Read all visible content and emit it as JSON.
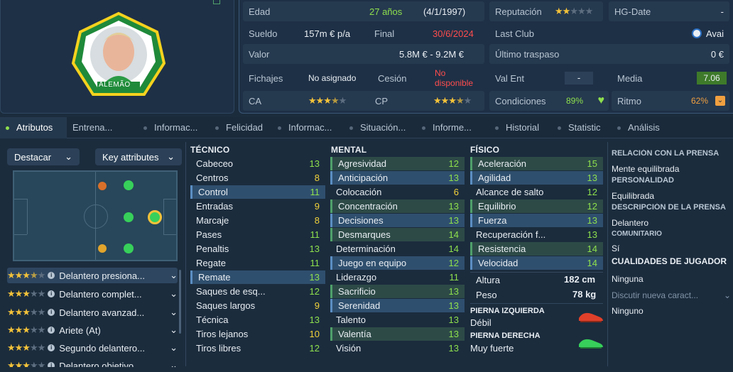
{
  "player": {
    "name": "ALEMÃO",
    "age": "27 años",
    "birthdate": "(4/1/1997)",
    "salary": "157m € p/a",
    "contract_end": "30/6/2024",
    "value": "5.8M € - 9.2M €",
    "transfers": "No asignado",
    "loan": "No disponible",
    "ca_stars": 3.5,
    "cp_stars": 3.5,
    "reputation_stars": 2,
    "hg_date": "-",
    "last_club": "Avai",
    "last_transfer": "0 €",
    "val_ent": "-",
    "average": "7.06",
    "condition": "89%",
    "rhythm": "62%"
  },
  "labels": {
    "age": "Edad",
    "salary": "Sueldo",
    "final": "Final",
    "value": "Valor",
    "transfers": "Fichajes",
    "loan": "Cesión",
    "ca": "CA",
    "cp": "CP",
    "reputation": "Reputación",
    "hg_date": "HG-Date",
    "last_club": "Last Club",
    "last_transfer": "Último traspaso",
    "val_ent": "Val Ent",
    "average": "Media",
    "condition": "Condiciones",
    "rhythm": "Ritmo"
  },
  "tabs": [
    "Atributos",
    "Entrena...",
    "Informac...",
    "Felicidad",
    "Informac...",
    "Situación...",
    "Informe...",
    "Historial",
    "Statistic",
    "Análisis"
  ],
  "controls": {
    "highlight": "Destacar",
    "key_attributes": "Key attributes"
  },
  "roles": [
    {
      "stars": 3.5,
      "name": "Delantero presiona..."
    },
    {
      "stars": 3,
      "name": "Delantero complet..."
    },
    {
      "stars": 3,
      "name": "Delantero avanzad..."
    },
    {
      "stars": 3,
      "name": "Ariete (At)"
    },
    {
      "stars": 3,
      "name": "Segundo delantero..."
    },
    {
      "stars": 3,
      "name": "Delantero objetivo..."
    }
  ],
  "technical": {
    "title": "TÉCNICO",
    "items": [
      {
        "name": "Cabeceo",
        "value": "13"
      },
      {
        "name": "Centros",
        "value": "8"
      },
      {
        "name": "Control",
        "value": "11"
      },
      {
        "name": "Entradas",
        "value": "9"
      },
      {
        "name": "Marcaje",
        "value": "8"
      },
      {
        "name": "Pases",
        "value": "11"
      },
      {
        "name": "Penaltis",
        "value": "13"
      },
      {
        "name": "Regate",
        "value": "11"
      },
      {
        "name": "Remate",
        "value": "13"
      },
      {
        "name": "Saques de esq...",
        "value": "12"
      },
      {
        "name": "Saques largos",
        "value": "9"
      },
      {
        "name": "Técnica",
        "value": "13"
      },
      {
        "name": "Tiros lejanos",
        "value": "10"
      },
      {
        "name": "Tiros libres",
        "value": "12"
      }
    ]
  },
  "mental": {
    "title": "MENTAL",
    "items": [
      {
        "name": "Agresividad",
        "value": "12"
      },
      {
        "name": "Anticipación",
        "value": "13"
      },
      {
        "name": "Colocación",
        "value": "6"
      },
      {
        "name": "Concentración",
        "value": "13"
      },
      {
        "name": "Decisiones",
        "value": "13"
      },
      {
        "name": "Desmarques",
        "value": "14"
      },
      {
        "name": "Determinación",
        "value": "14"
      },
      {
        "name": "Juego en equipo",
        "value": "12"
      },
      {
        "name": "Liderazgo",
        "value": "11"
      },
      {
        "name": "Sacrificio",
        "value": "13"
      },
      {
        "name": "Serenidad",
        "value": "13"
      },
      {
        "name": "Talento",
        "value": "13"
      },
      {
        "name": "Valentía",
        "value": "13"
      },
      {
        "name": "Visión",
        "value": "13"
      }
    ]
  },
  "physical": {
    "title": "FÍSICO",
    "items": [
      {
        "name": "Aceleración",
        "value": "15"
      },
      {
        "name": "Agilidad",
        "value": "13"
      },
      {
        "name": "Alcance de salto",
        "value": "12"
      },
      {
        "name": "Equilibrio",
        "value": "12"
      },
      {
        "name": "Fuerza",
        "value": "13"
      },
      {
        "name": "Recuperación f...",
        "value": "13"
      },
      {
        "name": "Resistencia",
        "value": "14"
      },
      {
        "name": "Velocidad",
        "value": "14"
      }
    ],
    "height_label": "Altura",
    "height": "182 cm",
    "weight_label": "Peso",
    "weight": "78 kg",
    "left_foot_label": "PIERNA IZQUIERDA",
    "left_foot": "Débil",
    "right_foot_label": "PIERNA DERECHA",
    "right_foot": "Muy fuerte"
  },
  "side": {
    "press_title": "RELACIÓN CON LA PRENSA",
    "press": "Mente equilibrada",
    "personality_title": "PERSONALIDAD",
    "personality": "Equilibrada",
    "description_title": "DESCRIPCIÓN DE LA PRENSA",
    "description": "Delantero",
    "community_title": "COMUNITARIO",
    "community": "Sí",
    "traits_title": "CUALIDADES DE JUGADOR",
    "traits": "Ninguna",
    "discuss": "Discutir nueva caract...",
    "discuss_value": "Ninguno"
  },
  "colors": {
    "background": "#1b2c3d",
    "accent_green": "#8ee04d",
    "accent_yellow": "#f2d23a",
    "accent_red": "#ff4d4d",
    "star": "#f3c23a"
  }
}
